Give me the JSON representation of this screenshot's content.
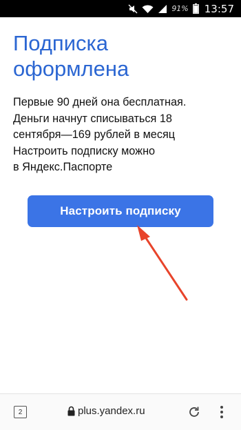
{
  "status_bar": {
    "battery": "91%",
    "time": "13:57",
    "icons": [
      "mute-icon",
      "wifi-icon",
      "signal-icon",
      "battery-icon"
    ]
  },
  "page": {
    "title_lines": [
      "Подписка",
      "оформлена"
    ],
    "description_lines": [
      "Первые 90 дней она бесплатная.",
      "Деньги начнут списываться 18",
      "сентября—169 рублей в месяц",
      "Настроить подписку можно",
      "в Яндекс.Паспорте"
    ],
    "primary_button": "Настроить подписку"
  },
  "browser": {
    "tab_count": "2",
    "url": "plus.yandex.ru",
    "icons": [
      "lock-icon",
      "reload-icon",
      "menu-icon"
    ]
  },
  "colors": {
    "title": "#2b66d2",
    "button": "#3b74e6",
    "annotation_arrow": "#e8442b"
  }
}
